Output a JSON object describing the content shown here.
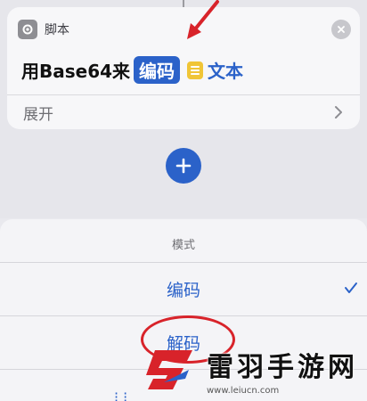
{
  "card": {
    "app_name": "脚本",
    "action_prefix": "用Base64来",
    "token_mode": "编码",
    "token_input": "文本",
    "expand_label": "展开"
  },
  "sheet": {
    "title": "模式",
    "options": [
      {
        "label": "编码",
        "selected": true
      },
      {
        "label": "解码",
        "selected": false
      }
    ],
    "footer_partial": "⁝ ⁝"
  },
  "watermark": {
    "title": "雷羽手游网",
    "url": "www.leiucn.com"
  },
  "colors": {
    "accent": "#2b62c9",
    "annotation": "#d8232a"
  }
}
